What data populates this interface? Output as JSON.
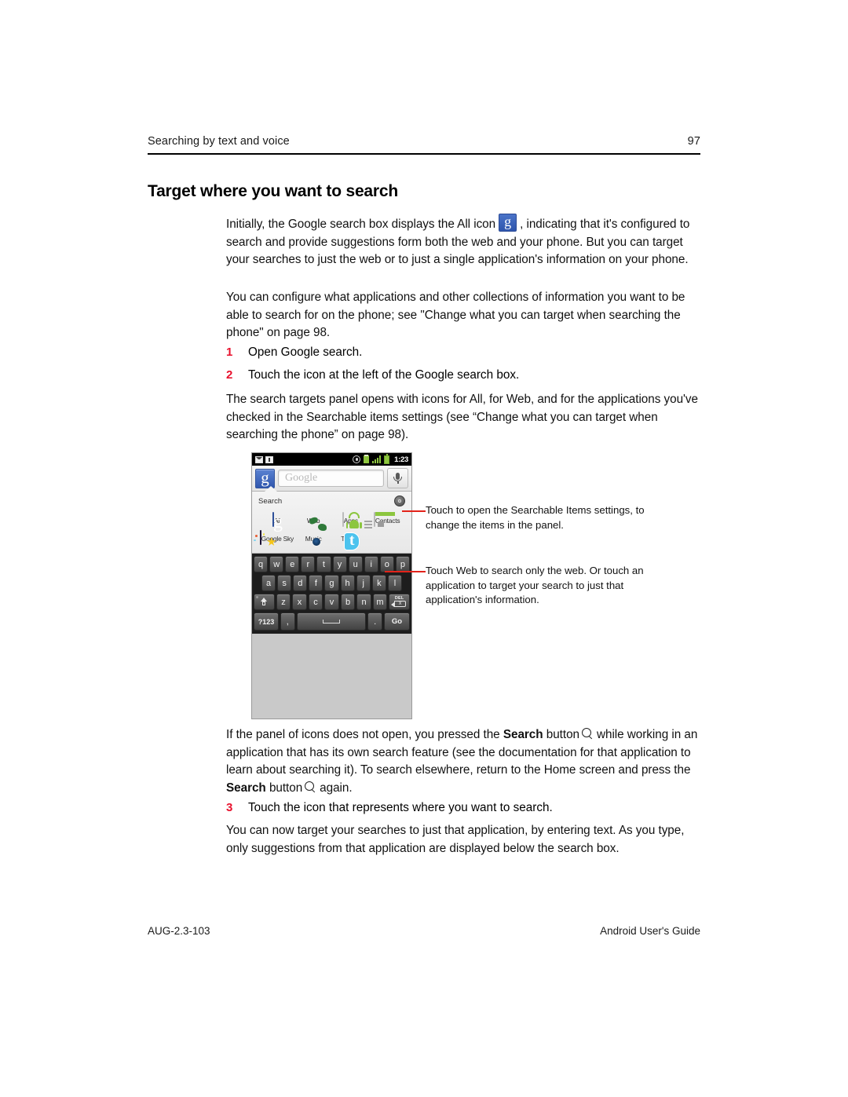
{
  "header": {
    "section": "Searching by text and voice",
    "page_number": "97"
  },
  "page_title": "Target where you want to search",
  "paragraphs": {
    "intro_a": "Initially, the Google search box displays the All icon",
    "intro_b": ", indicating that it's configured to search and provide suggestions form both the web and your phone. But you can target your searches to just the web or to just a single application's information on your phone.",
    "configure": "You can configure what applications and other collections of information you want to be able to search for on the phone; see \"Change what you can target when searching the phone\" on page 98.",
    "panel_opens": "The search targets panel opens with icons for All, for Web, and for the applications you've checked in the Searchable items settings (see “Change what you can target when searching the phone” on page 98).",
    "not_open_a": "If the panel of icons does not open, you pressed the",
    "not_open_search1": "Search",
    "not_open_b": "button",
    "not_open_c": "while working in an application that has its own search feature (see the documentation for that application to learn about searching it). To search elsewhere, return to the Home screen and press the",
    "not_open_search2": "Search",
    "not_open_d": "button",
    "not_open_e": "again.",
    "now_target": "You can now target your searches to just that application, by entering text. As you type, only suggestions from that application are displayed below the search box."
  },
  "steps": [
    {
      "num": "1",
      "text": "Open Google search."
    },
    {
      "num": "2",
      "text": "Touch the icon at the left of the Google search box."
    },
    {
      "num": "3",
      "text": "Touch the icon that represents where you want to search."
    }
  ],
  "callouts": [
    {
      "text": "Touch to open the Searchable Items settings, to change the items in the panel."
    },
    {
      "text": "Touch Web to search only the web. Or touch an application to target your search to just that application's information."
    }
  ],
  "phone": {
    "status_bar": {
      "clock": "1:23",
      "icons": [
        "mail-icon",
        "sim-icon",
        "gps-icon",
        "usb-icon",
        "signal-icon",
        "battery-icon"
      ]
    },
    "search_widget": {
      "badge_letter": "g",
      "placeholder": "Google",
      "mic_label": "voice-search"
    },
    "panel": {
      "label": "Search",
      "settings_icon": "gear-icon",
      "targets": [
        {
          "label": "All",
          "icon": "google-all-icon"
        },
        {
          "label": "Web",
          "icon": "globe-icon"
        },
        {
          "label": "Apps",
          "icon": "market-bag-icon"
        },
        {
          "label": "Contacts",
          "icon": "contacts-card-icon"
        },
        {
          "label": "Google Sky",
          "icon": "google-sky-icon"
        },
        {
          "label": "Music",
          "icon": "music-speaker-icon"
        },
        {
          "label": "Twitter",
          "icon": "twitter-bird-icon"
        }
      ]
    },
    "keyboard": {
      "row1": [
        "q",
        "w",
        "e",
        "r",
        "t",
        "y",
        "u",
        "i",
        "o",
        "p"
      ],
      "row2": [
        "a",
        "s",
        "d",
        "f",
        "g",
        "h",
        "j",
        "k",
        "l"
      ],
      "row3": [
        "z",
        "x",
        "c",
        "v",
        "b",
        "n",
        "m"
      ],
      "shift_label": "shift-key",
      "delete_label": "DEL",
      "row4": {
        "symbols": "?123",
        "comma": ",",
        "space": "space-key",
        "period": ".",
        "go": "Go"
      }
    }
  },
  "footer": {
    "left": "AUG-2.3-103",
    "right": "Android User's Guide"
  },
  "colors": {
    "accent_red": "#e8112d",
    "leader_red": "#e2231a",
    "google_blue": "#2f56ad",
    "android_green": "#8cc63f"
  }
}
